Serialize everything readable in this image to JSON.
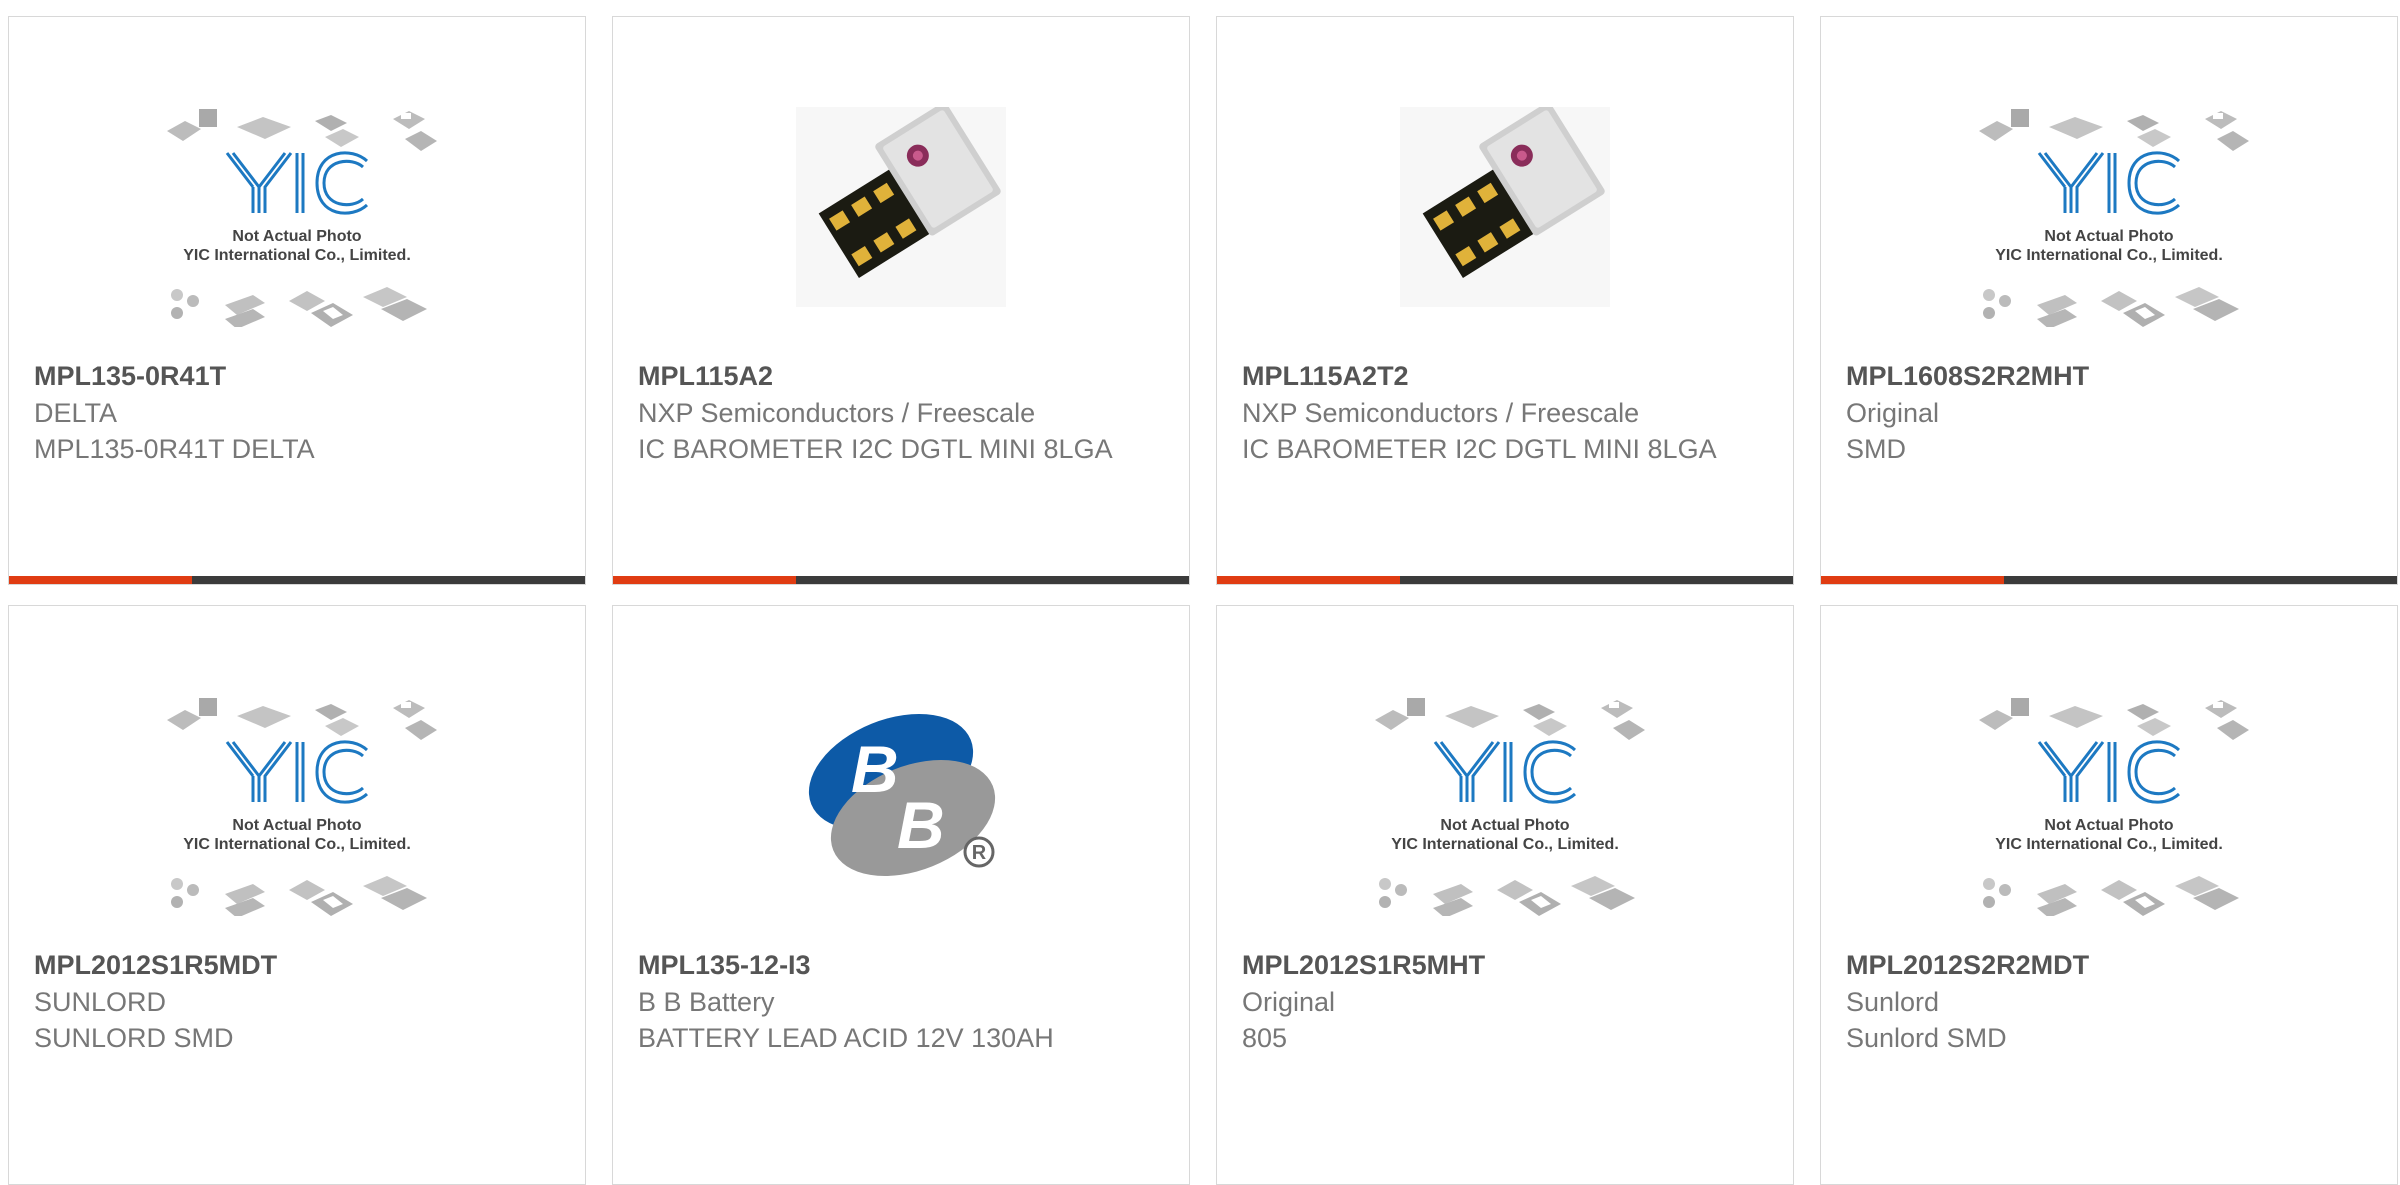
{
  "colors": {
    "accent": "#e03c12",
    "dark_bar": "#3b3b3b",
    "border": "#d8d8d8",
    "yic_blue": "#1d79c2",
    "bb_blue": "#0d5aa7"
  },
  "placeholder_image": {
    "icon": "yic-not-actual-photo",
    "line1": "Not Actual Photo",
    "line2": "YIC International Co., Limited."
  },
  "products": [
    {
      "part": "MPL135-0R41T",
      "manufacturer": "DELTA",
      "description": "MPL135-0R41T DELTA",
      "image": "yic-placeholder"
    },
    {
      "part": "MPL115A2",
      "manufacturer": "NXP Semiconductors / Freescale",
      "description": "IC BAROMETER I2C DGTL MINI 8LGA",
      "image": "sensor-chip"
    },
    {
      "part": "MPL115A2T2",
      "manufacturer": "NXP Semiconductors / Freescale",
      "description": "IC BAROMETER I2C DGTL MINI 8LGA",
      "image": "sensor-chip"
    },
    {
      "part": "MPL1608S2R2MHT",
      "manufacturer": "Original",
      "description": "SMD",
      "image": "yic-placeholder"
    },
    {
      "part": "MPL2012S1R5MDT",
      "manufacturer": "SUNLORD",
      "description": "SUNLORD SMD",
      "image": "yic-placeholder"
    },
    {
      "part": "MPL135-12-I3",
      "manufacturer": "B B Battery",
      "description": "BATTERY LEAD ACID 12V 130AH",
      "image": "bb-battery-logo"
    },
    {
      "part": "MPL2012S1R5MHT",
      "manufacturer": "Original",
      "description": "805",
      "image": "yic-placeholder"
    },
    {
      "part": "MPL2012S2R2MDT",
      "manufacturer": "Sunlord",
      "description": "Sunlord SMD",
      "image": "yic-placeholder"
    }
  ]
}
